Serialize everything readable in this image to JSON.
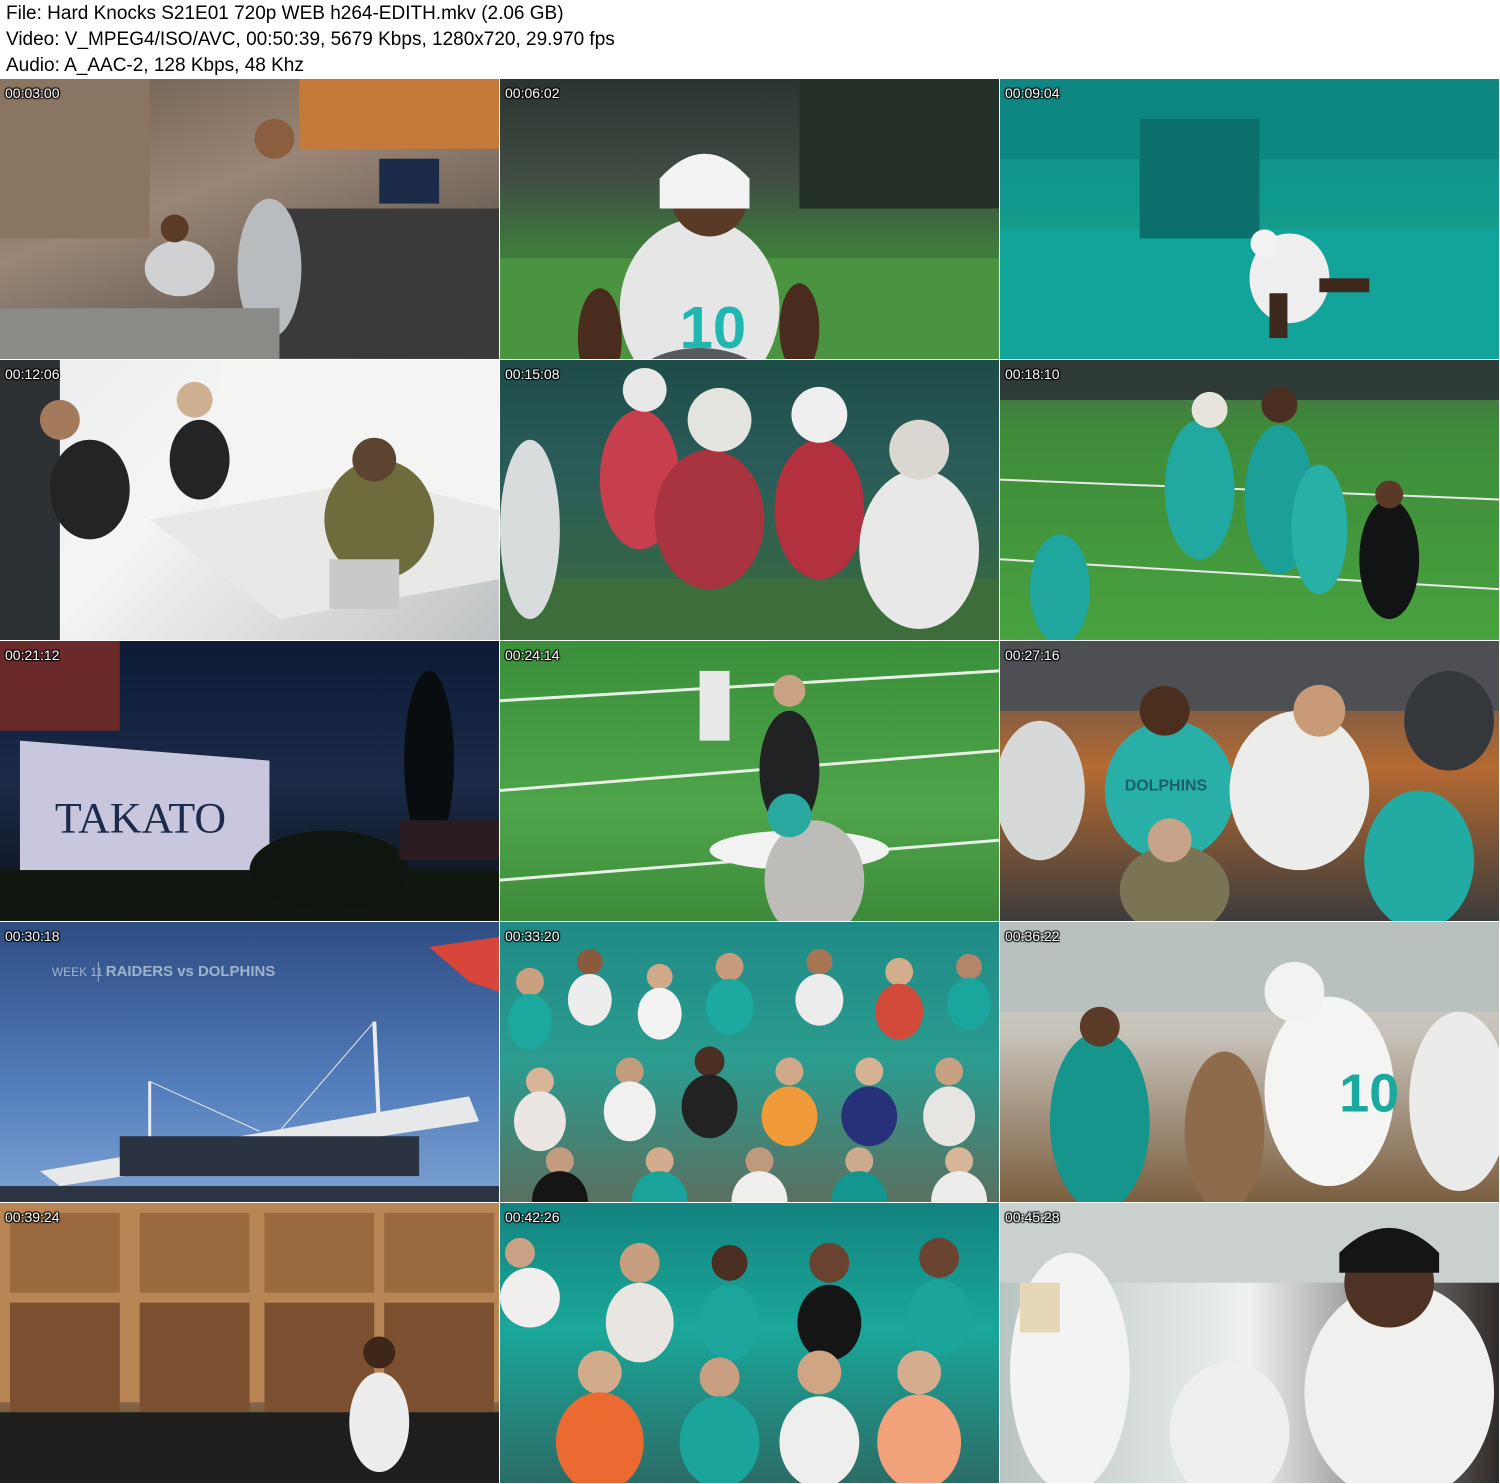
{
  "file_info": {
    "line1": "File: Hard Knocks S21E01 720p WEB h264-EDITH.mkv (2.06 GB)",
    "line2": "Video: V_MPEG4/ISO/AVC, 00:50:39, 5679 Kbps, 1280x720, 29.970 fps",
    "line3": "Audio: A_AAC-2, 128 Kbps, 48 Khz"
  },
  "thumbnails": [
    {
      "timestamp": "00:03:00"
    },
    {
      "timestamp": "00:06:02"
    },
    {
      "timestamp": "00:09:04"
    },
    {
      "timestamp": "00:12:06"
    },
    {
      "timestamp": "00:15:08"
    },
    {
      "timestamp": "00:18:10"
    },
    {
      "timestamp": "00:21:12",
      "sign_text": "TAKATO"
    },
    {
      "timestamp": "00:24:14"
    },
    {
      "timestamp": "00:27:16",
      "shirt_text": "DOLPHINS"
    },
    {
      "timestamp": "00:30:18",
      "week_text": "WEEK 11",
      "matchup_text": "RAIDERS vs DOLPHINS"
    },
    {
      "timestamp": "00:33:20"
    },
    {
      "timestamp": "00:36:22"
    },
    {
      "timestamp": "00:39:24"
    },
    {
      "timestamp": "00:42:26"
    },
    {
      "timestamp": "00:45:28"
    }
  ]
}
